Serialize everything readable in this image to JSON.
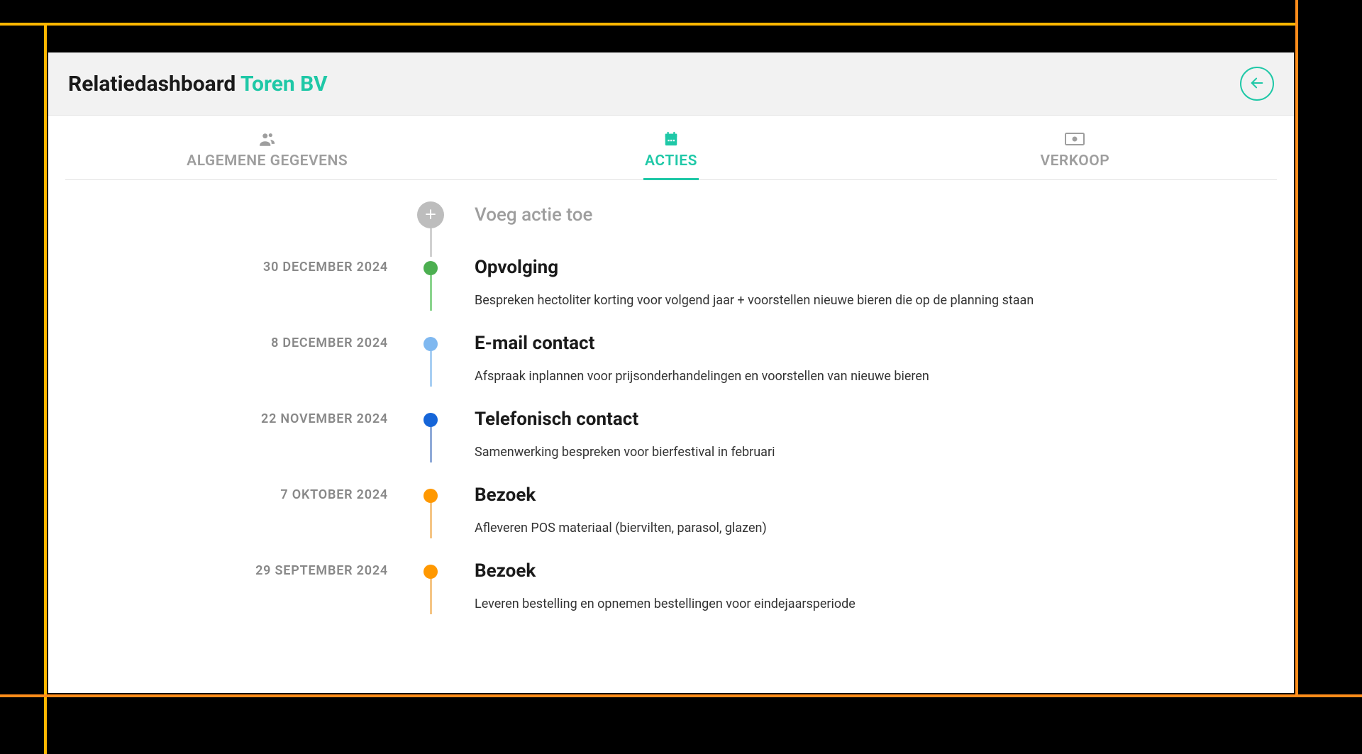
{
  "header": {
    "title_prefix": "Relatiedashboard ",
    "title_highlight": "Toren BV"
  },
  "tabs": {
    "general": "ALGEMENE GEGEVENS",
    "actions": "ACTIES",
    "sales": "VERKOOP"
  },
  "add": {
    "label": "Voeg actie toe"
  },
  "timeline": [
    {
      "date": "30 DECEMBER 2024",
      "title": "Opvolging",
      "desc": "Bespreken hectoliter korting voor volgend jaar + voorstellen nieuwe bieren die op de planning staan",
      "color": "green"
    },
    {
      "date": "8 DECEMBER 2024",
      "title": "E-mail contact",
      "desc": "Afspraak inplannen voor prijsonderhandelingen en voorstellen van nieuwe bieren",
      "color": "lightblue"
    },
    {
      "date": "22 NOVEMBER 2024",
      "title": "Telefonisch contact",
      "desc": "Samenwerking bespreken voor bierfestival in februari",
      "color": "blue"
    },
    {
      "date": "7 OKTOBER 2024",
      "title": "Bezoek",
      "desc": "Afleveren POS materiaal (biervilten, parasol, glazen)",
      "color": "orange"
    },
    {
      "date": "29 SEPTEMBER 2024",
      "title": "Bezoek",
      "desc": "Leveren bestelling en opnemen bestellingen voor eindejaarsperiode",
      "color": "orange"
    }
  ]
}
